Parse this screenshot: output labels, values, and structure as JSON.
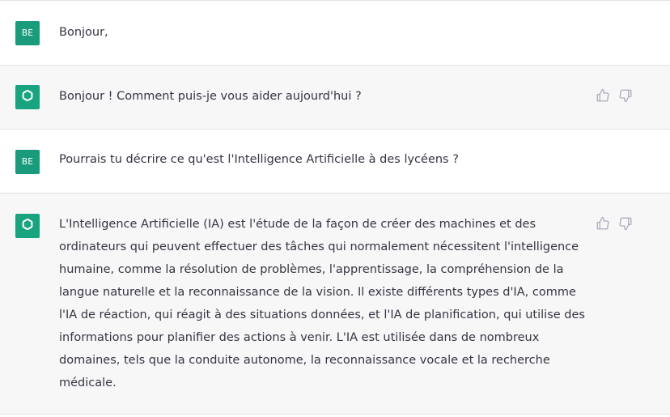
{
  "conversation": {
    "messages": [
      {
        "role": "user",
        "avatar_initials": "BE",
        "text": "Bonjour,"
      },
      {
        "role": "assistant",
        "text": "Bonjour ! Comment puis-je vous aider aujourd'hui ?"
      },
      {
        "role": "user",
        "avatar_initials": "BE",
        "text": "Pourrais tu décrire ce qu'est l'Intelligence Artificielle à des lycéens ?"
      },
      {
        "role": "assistant",
        "text": "L'Intelligence Artificielle (IA) est l'étude de la façon de créer des machines et des\nordinateurs qui peuvent effectuer des tâches qui normalement nécessitent l'intelligence\nhumaine, comme la résolution de problèmes, l'apprentissage, la compréhension de la\nlangue naturelle et la reconnaissance de la vision. Il existe différents types d'IA, comme\nl'IA de réaction, qui réagit à des situations données, et l'IA de planification, qui utilise des\ninformations pour planifier des actions à venir. L'IA est utilisée dans de nombreux\ndomaines, tels que la conduite autonome, la reconnaissance vocale et la recherche\nmédicale."
      }
    ]
  },
  "icons": {
    "assistant_avatar": "openai-logo-icon",
    "feedback_positive": "thumbs-up-icon",
    "feedback_negative": "thumbs-down-icon"
  },
  "colors": {
    "avatar_bg": "#1a9c7c",
    "assistant_row_bg": "#f7f7f8",
    "user_row_bg": "#ffffff",
    "text": "#343541",
    "icon": "#acacbe"
  }
}
